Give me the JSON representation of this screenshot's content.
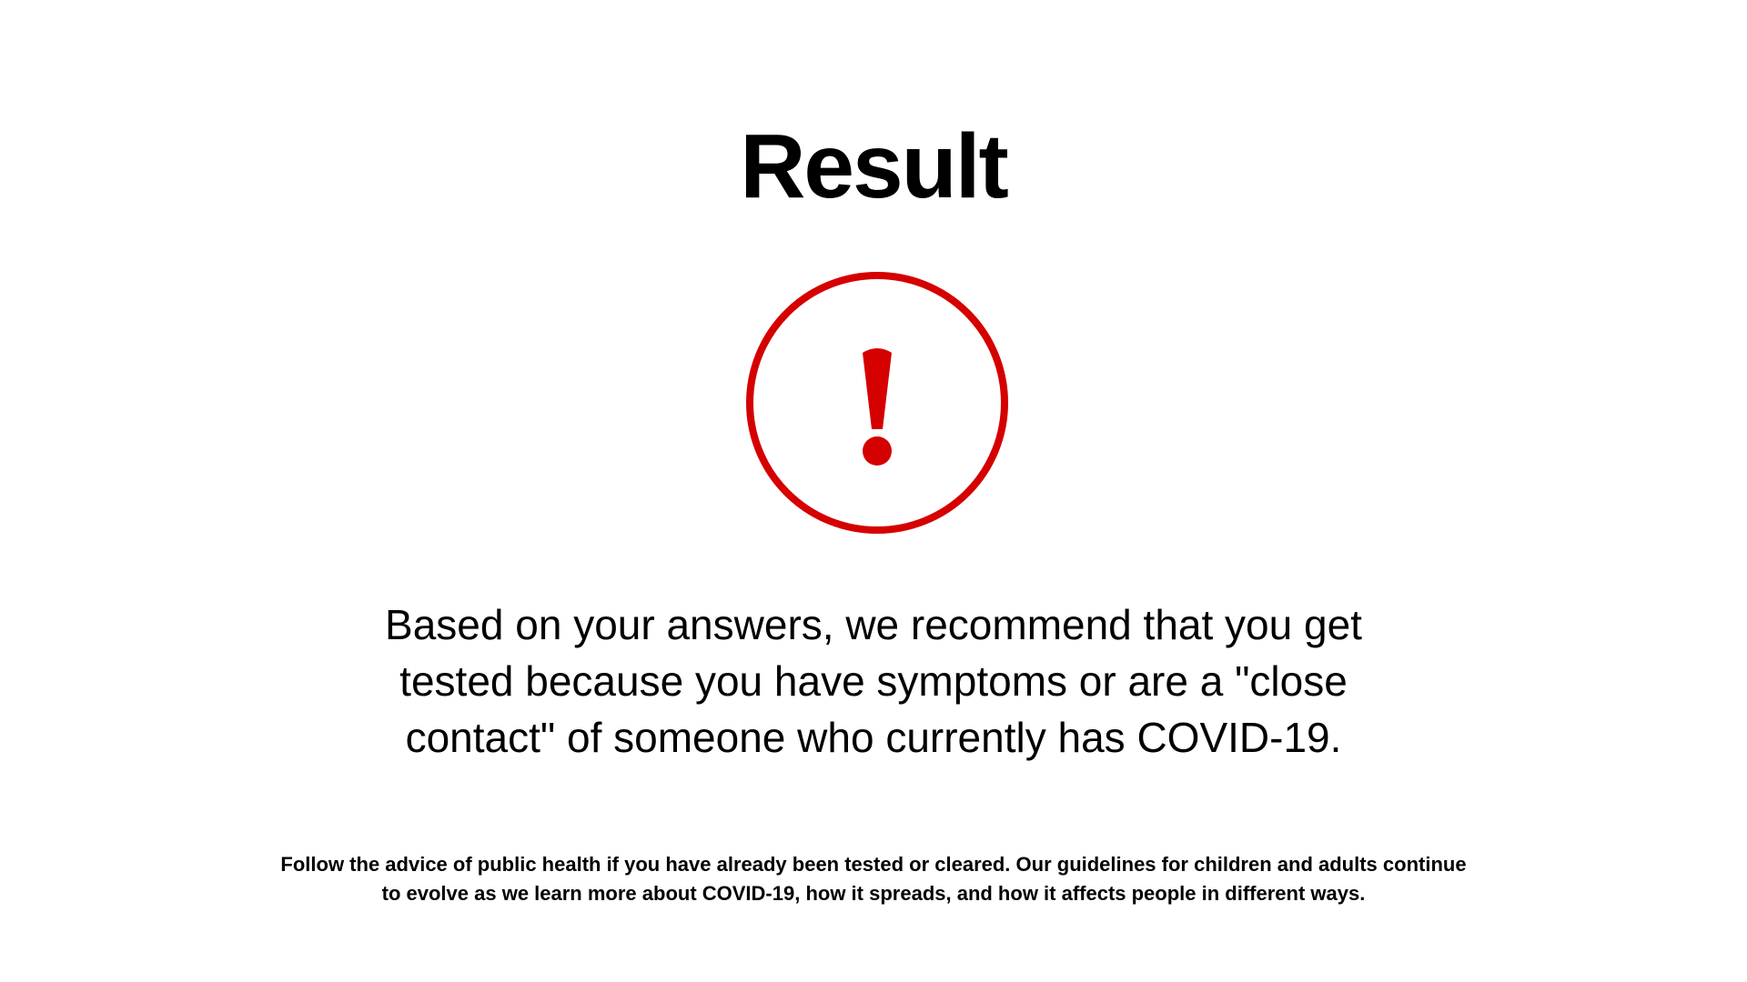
{
  "header": {
    "title": "Result"
  },
  "result_icon": {
    "icon": "exclamation-circle-icon",
    "color": "#d50000"
  },
  "main": {
    "recommendation": "Based on your answers, we recommend that you get tested because you have symptoms or are a \"close contact\" of someone who currently has COVID-19.",
    "disclaimer": "Follow the advice of public health if you have already been tested or cleared. Our guidelines for children and adults continue to evolve as we learn more about COVID-19, how it spreads, and how it affects people in different ways."
  }
}
